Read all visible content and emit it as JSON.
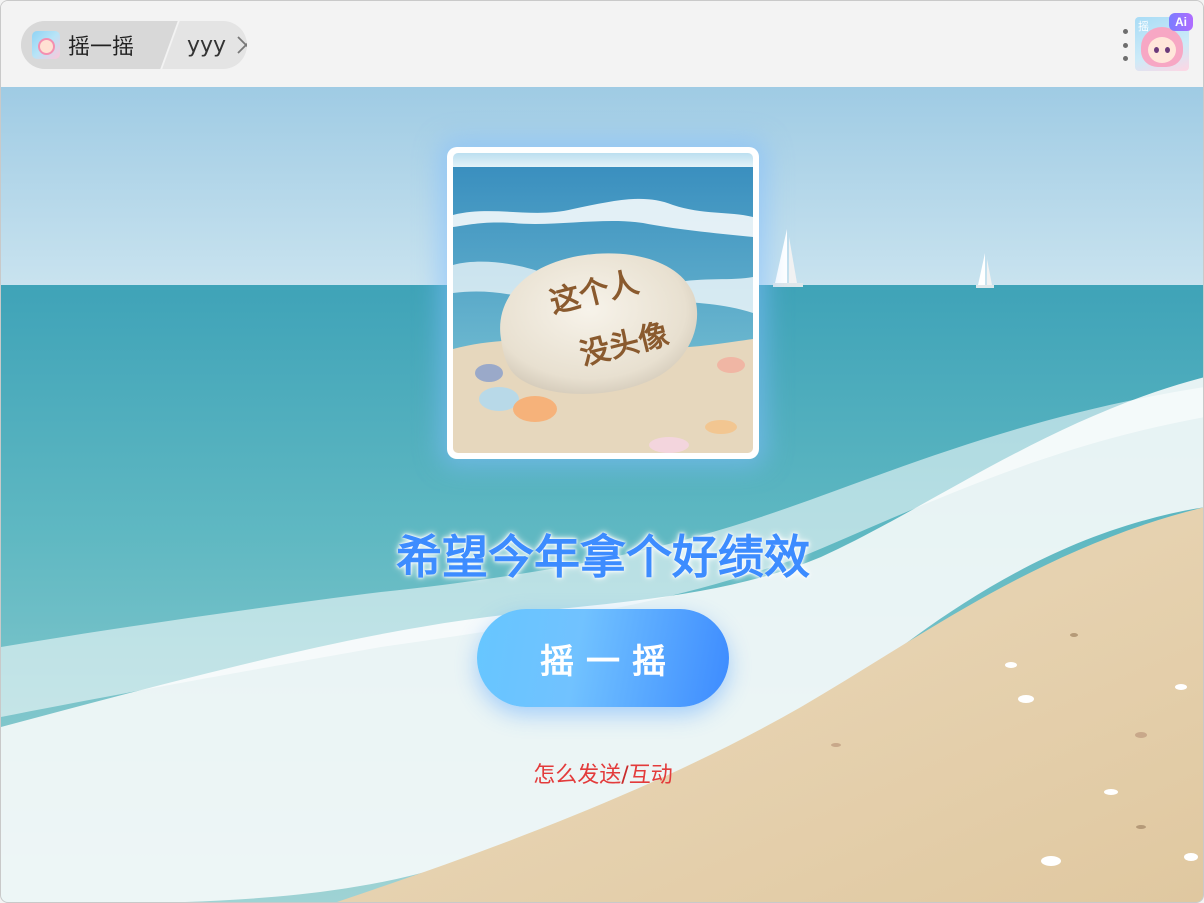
{
  "titlebar": {
    "home_tab_label": "摇一摇",
    "user_tab_label": "yyy",
    "avatar_badge_ai": "Ai",
    "avatar_badge_yao": "摇"
  },
  "profile": {
    "stone_line1": "这个人",
    "stone_line2": "没头像"
  },
  "main": {
    "wish_text": "希望今年拿个好绩效",
    "shake_button_label": "摇一摇",
    "help_link_send": "怎么发送",
    "help_separator": "/",
    "help_link_interact": "互动"
  },
  "colors": {
    "accent_blue": "#3d8cff",
    "button_light": "#66c6ff",
    "help_red": "#e33b3b"
  }
}
